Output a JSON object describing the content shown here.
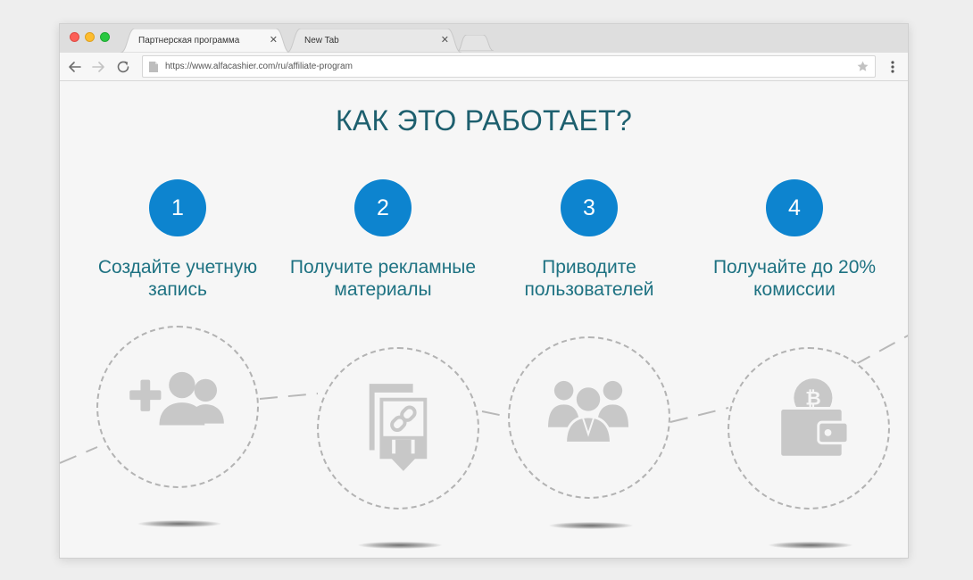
{
  "browser": {
    "tabs": [
      {
        "label": "Партнерская программа",
        "active": true
      },
      {
        "label": "New Tab",
        "active": false
      }
    ],
    "close_glyph": "✕",
    "url": "https://www.alfacashier.com/ru/affiliate-program",
    "icons": {
      "back": "arrow-left-icon",
      "forward": "arrow-right-icon",
      "reload": "reload-icon",
      "page": "page-icon",
      "star": "star-icon",
      "menu": "more-vertical-icon"
    }
  },
  "page": {
    "title": "КАК ЭТО РАБОТАЕТ?",
    "steps": [
      {
        "number": "1",
        "text": "Создайте учетную запись",
        "icon": "add-user-icon"
      },
      {
        "number": "2",
        "text": "Получите рекламные материалы",
        "icon": "download-link-icon"
      },
      {
        "number": "3",
        "text": "Приводите пользователей",
        "icon": "users-group-icon"
      },
      {
        "number": "4",
        "text": "Получайте до 20% комиссии",
        "icon": "bitcoin-wallet-icon"
      }
    ]
  },
  "colors": {
    "accent": "#0d84cf",
    "title": "#1d5f6e",
    "step_text": "#1e7282",
    "icon_gray": "#c8c8c8",
    "dashed": "#b3b3b3"
  }
}
